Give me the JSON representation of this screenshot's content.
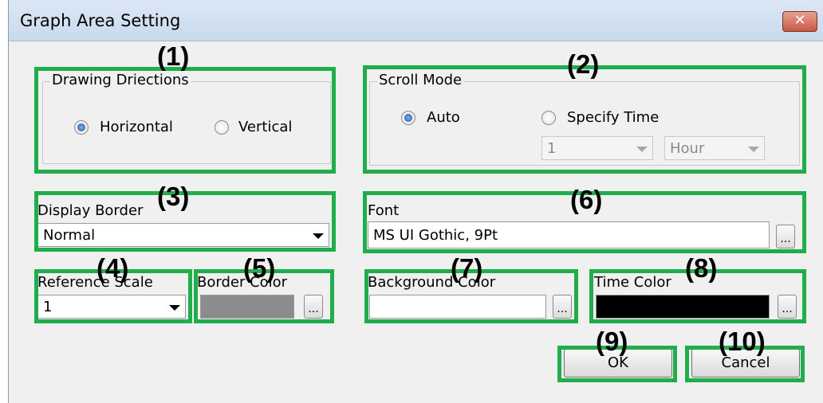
{
  "window": {
    "title": "Graph Area Setting",
    "close_glyph": "✕"
  },
  "drawing_directions": {
    "label": "Drawing Driections",
    "options": [
      {
        "label": "Horizontal",
        "checked": true
      },
      {
        "label": "Vertical",
        "checked": false
      }
    ]
  },
  "scroll_mode": {
    "label": "Scroll Mode",
    "options": [
      {
        "label": "Auto",
        "checked": true
      },
      {
        "label": "Specify Time",
        "checked": false
      }
    ],
    "amount_value": "1",
    "unit_value": "Hour"
  },
  "display_border": {
    "label": "Display Border",
    "value": "Normal"
  },
  "font": {
    "label": "Font",
    "value": "MS UI Gothic, 9Pt",
    "browse_label": "..."
  },
  "reference_scale": {
    "label": "Reference Scale",
    "value": "1"
  },
  "border_color": {
    "label": "Border Color",
    "color": "#8c8c8c",
    "browse_label": "..."
  },
  "background_color": {
    "label": "Background Color",
    "color": "#ffffff",
    "browse_label": "..."
  },
  "time_color": {
    "label": "Time Color",
    "color": "#000000",
    "browse_label": "..."
  },
  "buttons": {
    "ok": "OK",
    "cancel": "Cancel"
  },
  "callouts": [
    "(1)",
    "(2)",
    "(3)",
    "(4)",
    "(5)",
    "(6)",
    "(7)",
    "(8)",
    "(9)",
    "(10)"
  ],
  "colors": {
    "highlight": "#1fae4b",
    "titlebar": "#c9daee",
    "dialog": "#f0f0f0"
  }
}
